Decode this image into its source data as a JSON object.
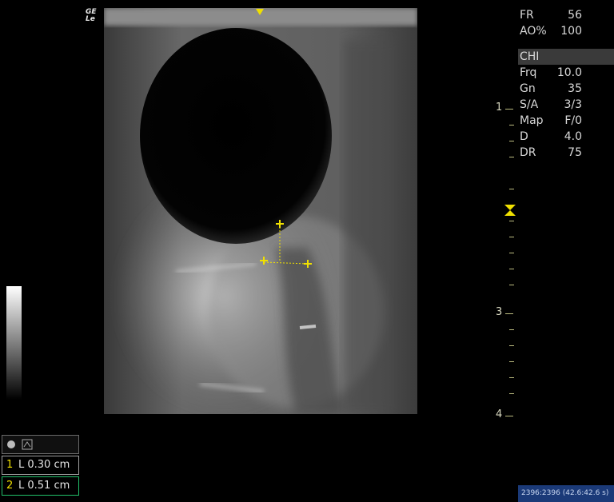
{
  "probe": {
    "line1": "GE",
    "line2": "Le"
  },
  "parameters": [
    {
      "key": "FR",
      "value": "56"
    },
    {
      "key": "AO%",
      "value": "100"
    },
    {
      "key": "CHI",
      "value": "",
      "highlight": true
    },
    {
      "key": "Frq",
      "value": "10.0"
    },
    {
      "key": "Gn",
      "value": "35"
    },
    {
      "key": "S/A",
      "value": "3/3"
    },
    {
      "key": "Map",
      "value": "F/0"
    },
    {
      "key": "D",
      "value": "4.0"
    },
    {
      "key": "DR",
      "value": "75"
    }
  ],
  "depth_labels": [
    "1",
    "3",
    "4"
  ],
  "measurements": [
    {
      "index": "1",
      "text": "L 0.30 cm"
    },
    {
      "index": "2",
      "text": "L 0.51 cm"
    }
  ],
  "status": "2396:2396 (42.6:42.6 s)",
  "colors": {
    "caliper": "#f0e000",
    "marker": "#f0e000",
    "status_bg": "#1b3a78"
  }
}
